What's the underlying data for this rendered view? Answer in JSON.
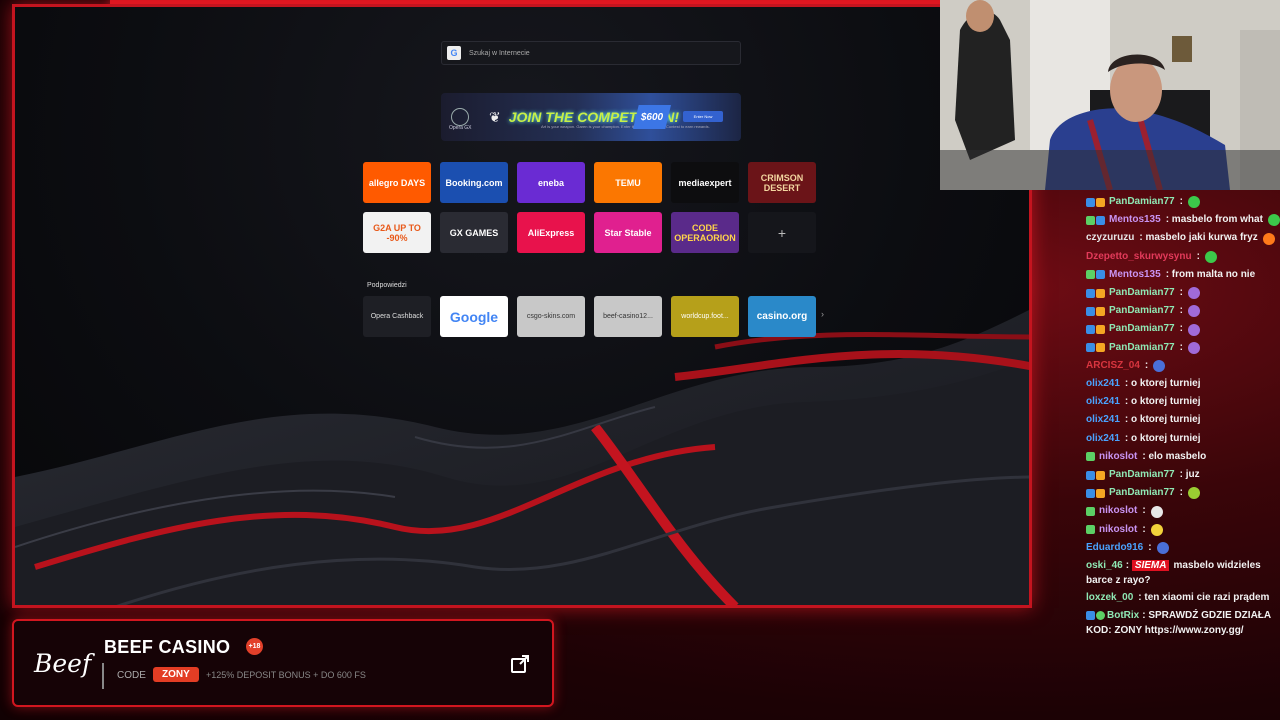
{
  "browser": {
    "search_placeholder": "Szukaj w Internecie",
    "banner": {
      "brand": "Opera GX",
      "title": "JOIN THE COMPETITION!",
      "subtitle": "Art is your weapon. Garen is your champion. Enter the Final Brand Art Contest to earn rewards.",
      "prize": "$600",
      "cta": "Enter Now"
    },
    "speed_dials": [
      {
        "label": "allegro DAYS",
        "bg": "#ff5a00",
        "color": "#fff"
      },
      {
        "label": "Booking.com",
        "bg": "#1b4fb0",
        "color": "#fff"
      },
      {
        "label": "eneba",
        "bg": "#6a2bd3",
        "color": "#fff"
      },
      {
        "label": "TEMU",
        "bg": "#fb7701",
        "color": "#fff"
      },
      {
        "label": "mediaexpert",
        "bg": "#0d0d0f",
        "color": "#fff"
      },
      {
        "label": "CRIMSON DESERT",
        "bg": "#6b1418",
        "color": "#f3d6a0"
      },
      {
        "label": "G2A UP TO -90%",
        "bg": "#f2f2f2",
        "color": "#e8591a"
      },
      {
        "label": "GX GAMES",
        "bg": "#2a2b33",
        "color": "#fff"
      },
      {
        "label": "AliExpress",
        "bg": "#e8124c",
        "color": "#fff"
      },
      {
        "label": "Star Stable",
        "bg": "#e0208f",
        "color": "#fff"
      },
      {
        "label": "CODE OPERAORION",
        "bg": "#5a2a8a",
        "color": "#ffd54a"
      },
      {
        "label": "+",
        "bg": "#15161b",
        "color": "#bbb"
      }
    ],
    "suggestions_label": "Podpowiedzi",
    "suggestions": [
      {
        "label": "Opera Cashback",
        "bg": "#1e1f25",
        "color": "#ddd"
      },
      {
        "label": "Google",
        "bg": "#ffffff",
        "color": "#4285f4"
      },
      {
        "label": "csgo-skins.com",
        "bg": "#c8c8c8",
        "color": "#333"
      },
      {
        "label": "beef-casino12...",
        "bg": "#c8c8c8",
        "color": "#333"
      },
      {
        "label": "worldcup.foot...",
        "bg": "#b6a01a",
        "color": "#fff"
      },
      {
        "label": "casino.org",
        "bg": "#2a89c9",
        "color": "#fff"
      }
    ]
  },
  "sponsor": {
    "logo": "Beef",
    "title": "BEEF CASINO",
    "age": "+18",
    "code_label": "CODE",
    "code": "ZONY",
    "offer": "+125% DEPOSIT BONUS + DO 600 FS"
  },
  "chat": [
    {
      "user": "PanDamian77",
      "color": "#8fe8b4",
      "badges": [
        "#3a8ee6",
        "#f5a623"
      ],
      "text": ":",
      "emote": "#3cc94a"
    },
    {
      "user": "Mentos135",
      "color": "#c994f2",
      "badges": [
        "#5cd065",
        "#3a8ee6"
      ],
      "text": ": masbelo from what",
      "emote": "#3cc94a"
    },
    {
      "user": "czyzuruzu",
      "color": "#e6e6e6",
      "badges": [],
      "text": ": masbelo jaki kurwa fryz",
      "emote": "#ff7a1a"
    },
    {
      "user": "Dzepetto_skurwysynu",
      "color": "#e23a5a",
      "badges": [],
      "text": ":",
      "emote": "#3cc94a"
    },
    {
      "user": "Mentos135",
      "color": "#c994f2",
      "badges": [
        "#5cd065",
        "#3a8ee6"
      ],
      "text": ": from malta no nie",
      "emote": ""
    },
    {
      "user": "PanDamian77",
      "color": "#8fe8b4",
      "badges": [
        "#3a8ee6",
        "#f5a623"
      ],
      "text": ":",
      "emote": "#a06ad8"
    },
    {
      "user": "PanDamian77",
      "color": "#8fe8b4",
      "badges": [
        "#3a8ee6",
        "#f5a623"
      ],
      "text": ":",
      "emote": "#a06ad8"
    },
    {
      "user": "PanDamian77",
      "color": "#8fe8b4",
      "badges": [
        "#3a8ee6",
        "#f5a623"
      ],
      "text": ":",
      "emote": "#a06ad8"
    },
    {
      "user": "PanDamian77",
      "color": "#8fe8b4",
      "badges": [
        "#3a8ee6",
        "#f5a623"
      ],
      "text": ":",
      "emote": "#a06ad8"
    },
    {
      "user": "ARCISZ_04",
      "color": "#d8353f",
      "badges": [],
      "text": ":",
      "emote": "#4a6fd8"
    },
    {
      "user": "olix241",
      "color": "#4aa3ff",
      "badges": [],
      "text": ": o ktorej turniej",
      "emote": ""
    },
    {
      "user": "olix241",
      "color": "#4aa3ff",
      "badges": [],
      "text": ": o ktorej turniej",
      "emote": ""
    },
    {
      "user": "olix241",
      "color": "#4aa3ff",
      "badges": [],
      "text": ": o ktorej turniej",
      "emote": ""
    },
    {
      "user": "olix241",
      "color": "#4aa3ff",
      "badges": [],
      "text": ": o ktorej turniej",
      "emote": ""
    },
    {
      "user": "nikoslot",
      "color": "#c994f2",
      "badges": [
        "#5cd065"
      ],
      "text": ": elo masbelo",
      "emote": ""
    },
    {
      "user": "PanDamian77",
      "color": "#8fe8b4",
      "badges": [
        "#3a8ee6",
        "#f5a623"
      ],
      "text": ": juz",
      "emote": ""
    },
    {
      "user": "PanDamian77",
      "color": "#8fe8b4",
      "badges": [
        "#3a8ee6",
        "#f5a623"
      ],
      "text": ":",
      "emote": "#9acd32"
    },
    {
      "user": "nikoslot",
      "color": "#c994f2",
      "badges": [
        "#5cd065"
      ],
      "text": ":",
      "emote": "#e8e8e8"
    },
    {
      "user": "nikoslot",
      "color": "#c994f2",
      "badges": [
        "#5cd065"
      ],
      "text": ":",
      "emote": "#f2d23a"
    },
    {
      "user": "Eduardo916",
      "color": "#4aa3ff",
      "badges": [],
      "text": ":",
      "emote": "#4a6fd8"
    }
  ],
  "chat_special": {
    "oski_user": "oski_46",
    "oski_color": "#8fe8b4",
    "oski_siema": "SIEMA",
    "oski_text": "masbelo widzieles barce z rayo?",
    "loxzek_user": "loxzek_00",
    "loxzek_color": "#8fe8b4",
    "loxzek_text": ": ten xiaomi cie razi prądem",
    "botrix_user": "BotRix",
    "botrix_color": "#8fe8b4",
    "botrix_text": ": SPRAWDŹ GDZIE DZIAŁA KOD: ZONY https://www.zony.gg/"
  },
  "colors": {
    "accent": "#d7151f",
    "code_pill": "#e33d24"
  }
}
